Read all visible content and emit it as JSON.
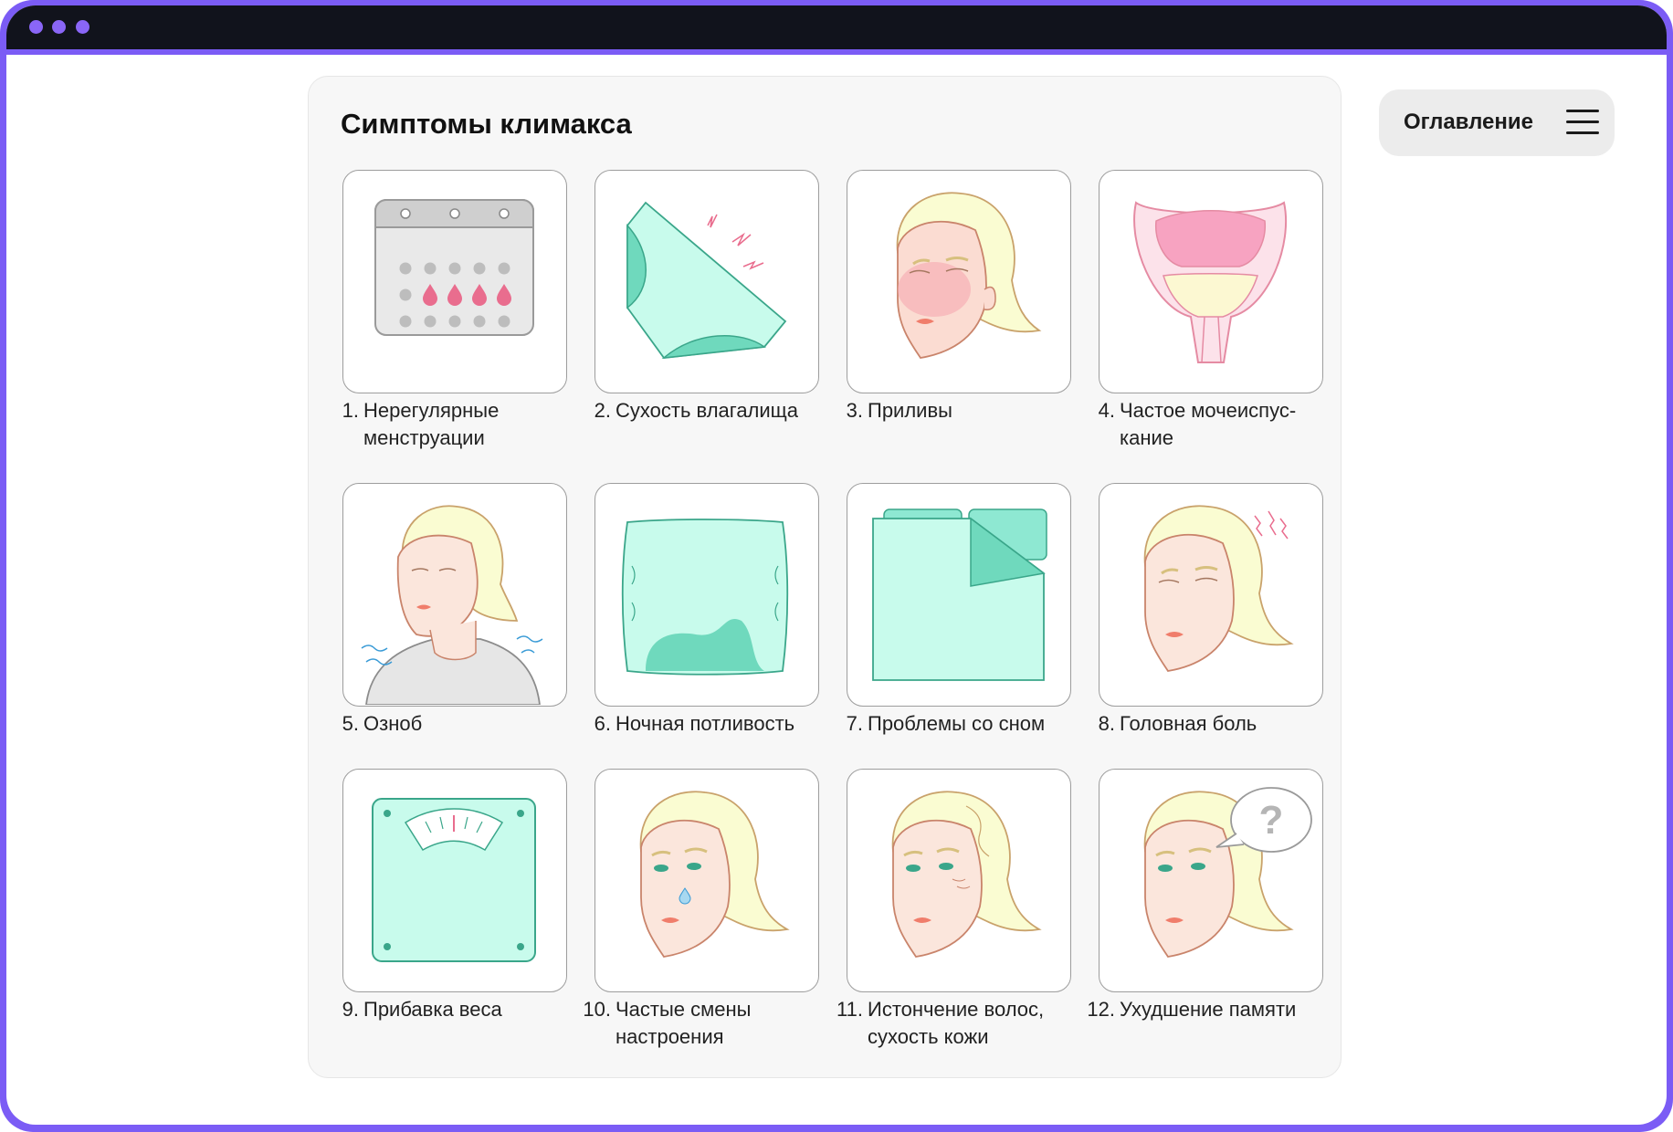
{
  "article": {
    "title": "Симптомы климакса",
    "items": [
      {
        "num": "1.",
        "text": "Нерегулярные менструации",
        "icon": "calendar-icon"
      },
      {
        "num": "2.",
        "text": "Сухость влагалища",
        "icon": "underwear-icon"
      },
      {
        "num": "3.",
        "text": "Приливы",
        "icon": "flushed-face-icon"
      },
      {
        "num": "4.",
        "text": "Частое мочеиспус-кание",
        "icon": "bladder-icon"
      },
      {
        "num": "5.",
        "text": "Озноб",
        "icon": "chills-icon"
      },
      {
        "num": "6.",
        "text": "Ночная потливость",
        "icon": "pillow-icon"
      },
      {
        "num": "7.",
        "text": "Проблемы со сном",
        "icon": "bed-sheet-icon"
      },
      {
        "num": "8.",
        "text": "Головная боль",
        "icon": "headache-icon"
      },
      {
        "num": "9.",
        "text": "Прибавка веса",
        "icon": "scale-icon"
      },
      {
        "num": "10.",
        "text": "Частые смены настроения",
        "icon": "crying-face-icon"
      },
      {
        "num": "11.",
        "text": "Истончение волос, сухость кожи",
        "icon": "aging-face-icon"
      },
      {
        "num": "12.",
        "text": "Ухудшение памяти",
        "icon": "forgetful-face-icon"
      }
    ]
  },
  "toc": {
    "label": "Оглавление",
    "icon": "hamburger-menu-icon"
  },
  "colors": {
    "frame": "#7b5cf5",
    "titlebar": "#11131c",
    "mint": "#c8fbec",
    "mint_dark": "#6fd9bd",
    "pink": "#e96d8e",
    "hair": "#fafcd2",
    "skin": "#fbe6dc"
  }
}
